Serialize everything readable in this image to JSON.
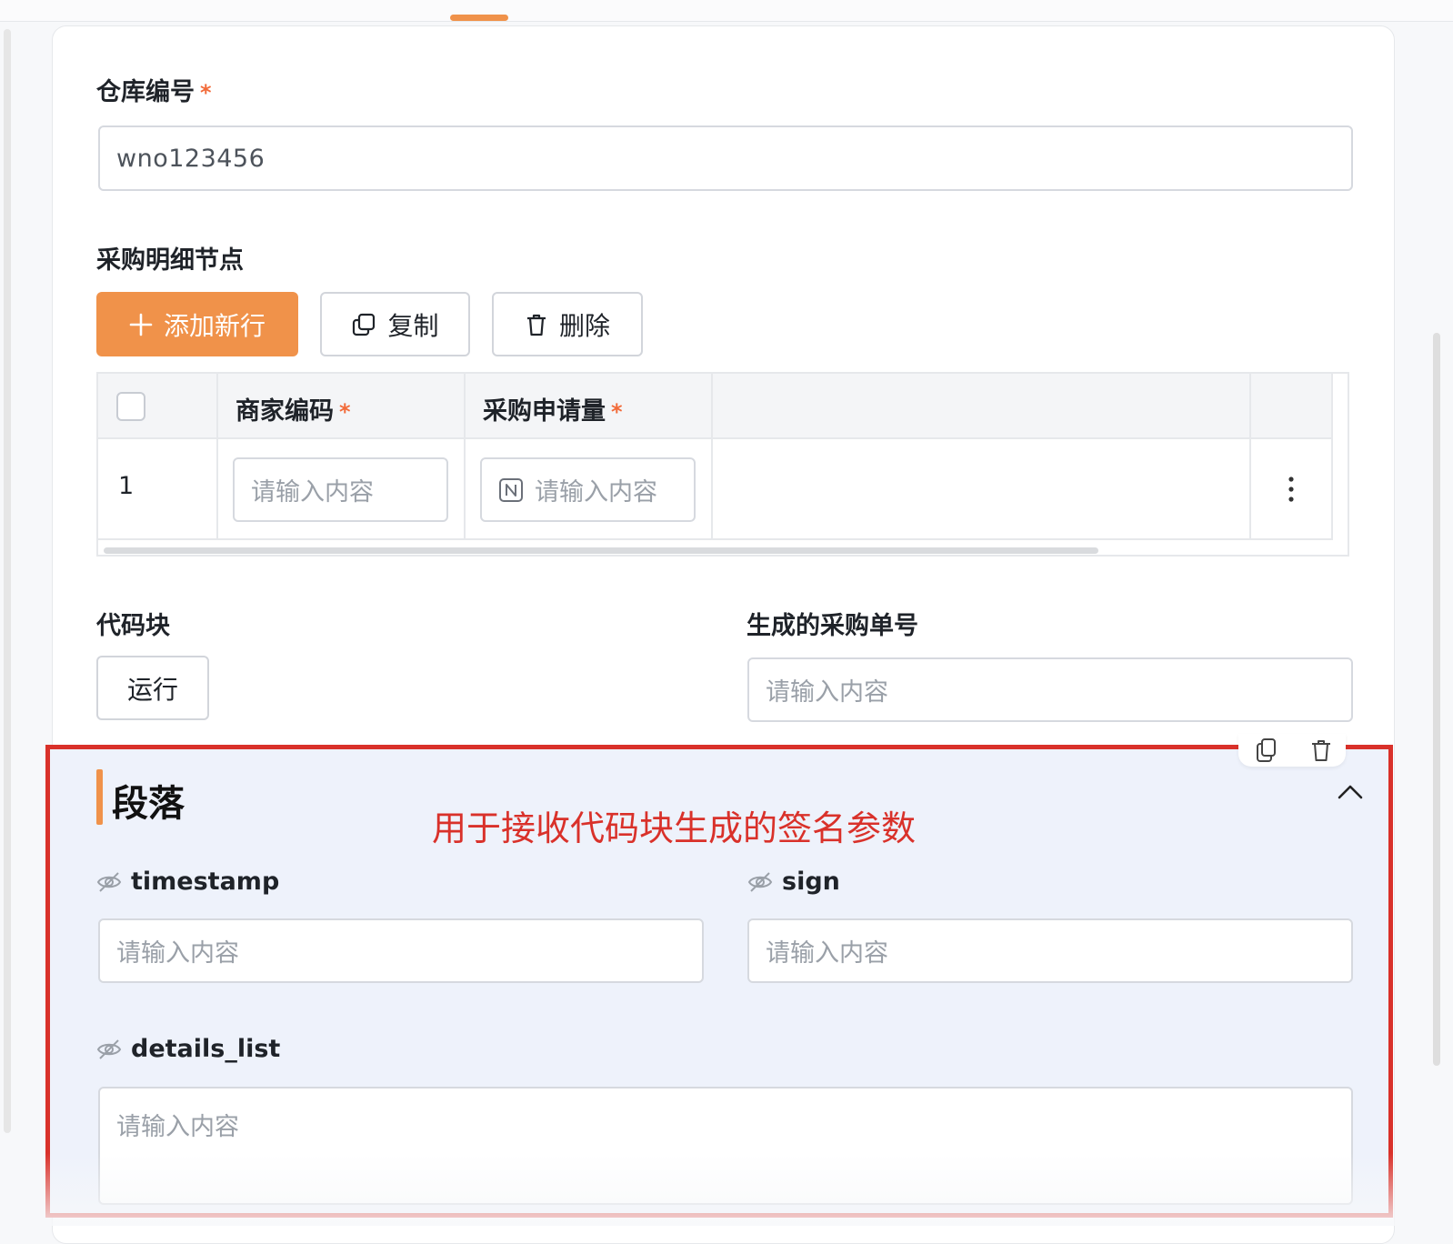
{
  "form": {
    "warehouse_no": {
      "label": "仓库编号",
      "required_mark": "*",
      "value": "wno123456"
    },
    "purchase_detail": {
      "label": "采购明细节点",
      "toolbar": {
        "add_label": "添加新行",
        "copy_label": "复制",
        "delete_label": "删除"
      },
      "table": {
        "columns": [
          {
            "label": "商家编码",
            "required_mark": "*"
          },
          {
            "label": "采购申请量",
            "required_mark": "*"
          }
        ],
        "rows": [
          {
            "index": "1",
            "merchant_code_placeholder": "请输入内容",
            "quantity_placeholder": "请输入内容"
          }
        ]
      }
    },
    "code_block": {
      "label": "代码块",
      "run_label": "运行"
    },
    "generated_po": {
      "label": "生成的采购单号",
      "placeholder": "请输入内容"
    },
    "paragraph": {
      "title": "段落",
      "annotation": "用于接收代码块生成的签名参数",
      "fields": {
        "timestamp": {
          "label": "timestamp",
          "placeholder": "请输入内容"
        },
        "sign": {
          "label": "sign",
          "placeholder": "请输入内容"
        },
        "details_list": {
          "label": "details_list",
          "placeholder": "请输入内容"
        }
      }
    }
  },
  "icons": {
    "add": "plus-icon",
    "copy": "copy-icon",
    "delete": "trash-icon",
    "number": "number-n-icon",
    "more": "vertical-dots-icon",
    "hidden": "eye-off-icon",
    "collapse": "chevron-up-icon"
  },
  "colors": {
    "accent": "#f0924a",
    "required": "#f26b3a",
    "annotation": "#d9312a",
    "section_bg": "#eef2fb"
  }
}
